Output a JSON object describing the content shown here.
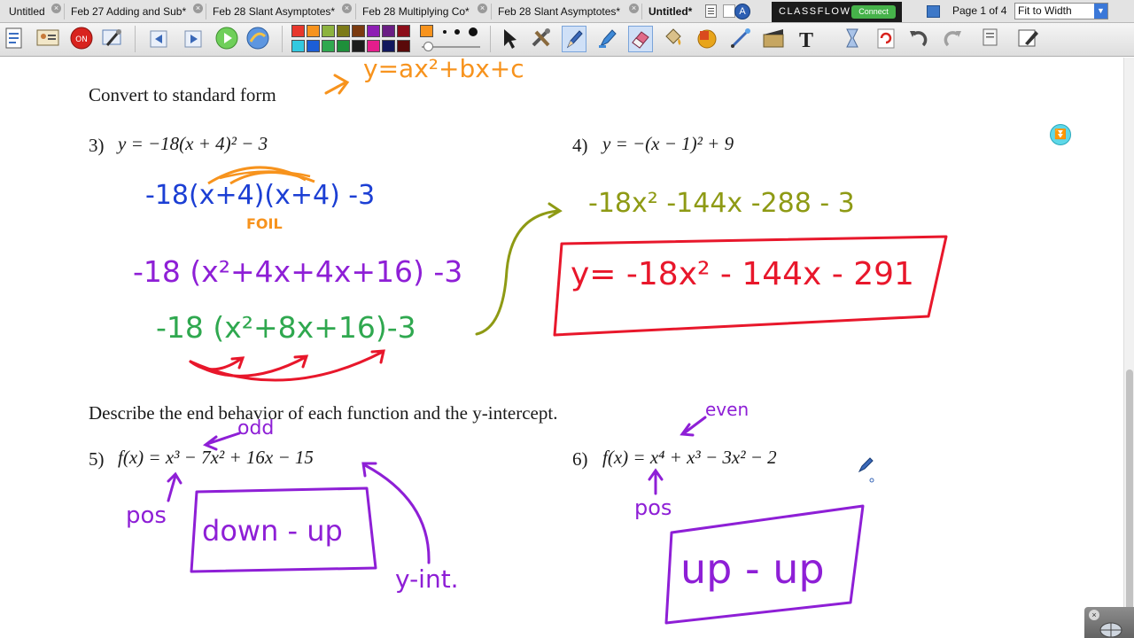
{
  "tabs": [
    {
      "label": "Untitled"
    },
    {
      "label": "Feb 27 Adding and Sub*"
    },
    {
      "label": "Feb 28 Slant Asymptotes*"
    },
    {
      "label": "Feb 28 Multiplying Co*"
    },
    {
      "label": "Feb 28 Slant Asymptotes*"
    },
    {
      "label": "Untitled*"
    }
  ],
  "classflow": {
    "logo": "CLASSFLOW",
    "connect_label": "Connect"
  },
  "page_indicator": "Page 1 of 4",
  "zoom": {
    "selected": "Fit to Width"
  },
  "palette": {
    "colors": [
      "#e8372c",
      "#f7931d",
      "#8db33f",
      "#7c7a18",
      "#7b3b10",
      "#8e1fb3",
      "#6a1e84",
      "#8b0e1a",
      "#33c9e0",
      "#1c5ed7",
      "#2fa84f",
      "#1e8f3a",
      "#1d1d1d",
      "#e41d8c",
      "#12185d",
      "#5a0a0a"
    ],
    "pen_color": "#f7931d"
  },
  "worksheet": {
    "heading_convert": "Convert to standard form",
    "problem3_num": "3)",
    "problem3_expr": "y = −18(x + 4)² − 3",
    "problem4_num": "4)",
    "problem4_expr": "y = −(x − 1)² + 9",
    "heading_describe": "Describe the end behavior of each function and the y-intercept.",
    "problem5_num": "5)",
    "problem5_expr": "f(x) = x³ − 7x² + 16x − 15",
    "problem6_num": "6)",
    "problem6_expr": "f(x) = x⁴ + x³ − 3x² − 2"
  },
  "handwriting": {
    "standard_form": "y=ax²+bx+c",
    "step1": "-18(x+4)(x+4) -3",
    "foil": "FOIL",
    "step2": "-18 (x²+4x+4x+16) -3",
    "step3": "-18 (x²+8x+16)-3",
    "step4": "-18x² -144x -288 - 3",
    "answer": "y= -18x² - 144x - 291",
    "odd": "odd",
    "pos5": "pos",
    "end_behavior5": "down - up",
    "yint": "y-int.",
    "even": "even",
    "pos6": "pos",
    "end_behavior6": "up - up"
  },
  "icons": {
    "collapse": "collapse-toolbox-icon",
    "pen": "pen-cursor-icon"
  }
}
